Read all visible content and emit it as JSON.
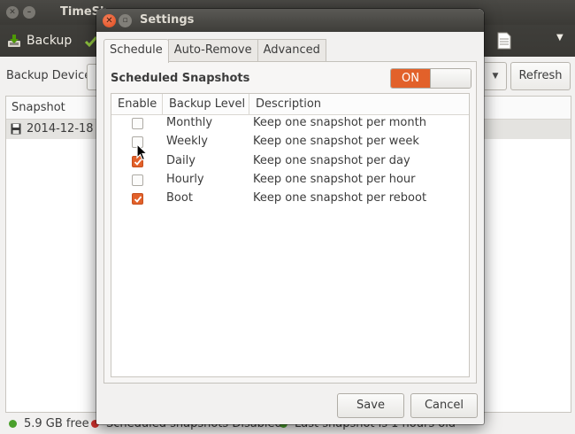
{
  "main_window": {
    "title": "TimeSh",
    "toolbar": {
      "backup_label": "Backup"
    },
    "device_label": "Backup Device",
    "refresh_label": "Refresh",
    "snapshot_column": "Snapshot",
    "snapshot_row": "2014-12-18 02",
    "status": {
      "free_space": "5.9 GB free",
      "scheduled": "Scheduled snapshots Disabled",
      "last_snapshot": "Last snapshot is 1 hours old"
    }
  },
  "dialog": {
    "title": "Settings",
    "tabs": [
      {
        "label": "Schedule",
        "active": true
      },
      {
        "label": "Auto-Remove",
        "active": false
      },
      {
        "label": "Advanced",
        "active": false
      }
    ],
    "heading": "Scheduled Snapshots",
    "toggle_label": "ON",
    "table": {
      "headers": {
        "enable": "Enable",
        "level": "Backup Level",
        "description": "Description"
      },
      "rows": [
        {
          "enabled": false,
          "level": "Monthly",
          "description": "Keep one snapshot per month"
        },
        {
          "enabled": false,
          "level": "Weekly",
          "description": "Keep one snapshot per week"
        },
        {
          "enabled": true,
          "level": "Daily",
          "description": "Keep one snapshot per day"
        },
        {
          "enabled": false,
          "level": "Hourly",
          "description": "Keep one snapshot per hour"
        },
        {
          "enabled": true,
          "level": "Boot",
          "description": "Keep one snapshot per reboot"
        }
      ]
    },
    "save_label": "Save",
    "cancel_label": "Cancel"
  },
  "colors": {
    "accent": "#e2612a",
    "status_green": "#4aa02c",
    "status_red": "#d0312d"
  }
}
